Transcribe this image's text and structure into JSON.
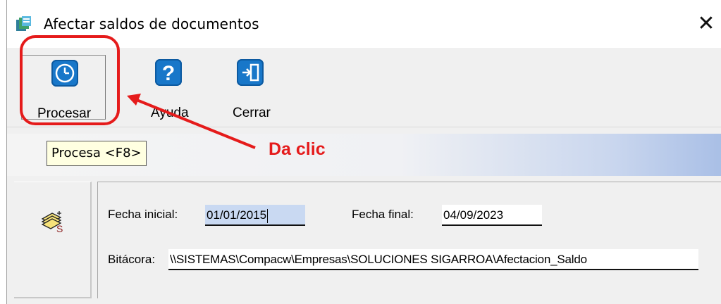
{
  "window": {
    "title": "Afectar saldos de documentos",
    "close_glyph": "✕",
    "icon": "document-stack-icon"
  },
  "toolbar": {
    "procesar": {
      "label": "Procesar",
      "icon": "clock-icon"
    },
    "ayuda": {
      "label": "Ayuda",
      "icon": "question-icon"
    },
    "cerrar": {
      "label": "Cerrar",
      "icon": "exit-door-icon"
    }
  },
  "tooltip": {
    "text": "Procesa <F8>"
  },
  "annotation": {
    "text": "Da clic",
    "color": "#e51b1b"
  },
  "form": {
    "fecha_inicial_label": "Fecha inicial:",
    "fecha_inicial_value": "01/01/2015",
    "fecha_final_label": "Fecha final:",
    "fecha_final_value": "04/09/2023",
    "bitacora_label": "Bitácora:",
    "bitacora_value": "\\\\SISTEMAS\\Compacw\\Empresas\\SOLUCIONES SIGARROA\\Afectacion_Saldo"
  },
  "colors": {
    "accent_blue": "#1877c9",
    "highlight_red": "#e51b1b",
    "tooltip_bg": "#ffffe1"
  }
}
